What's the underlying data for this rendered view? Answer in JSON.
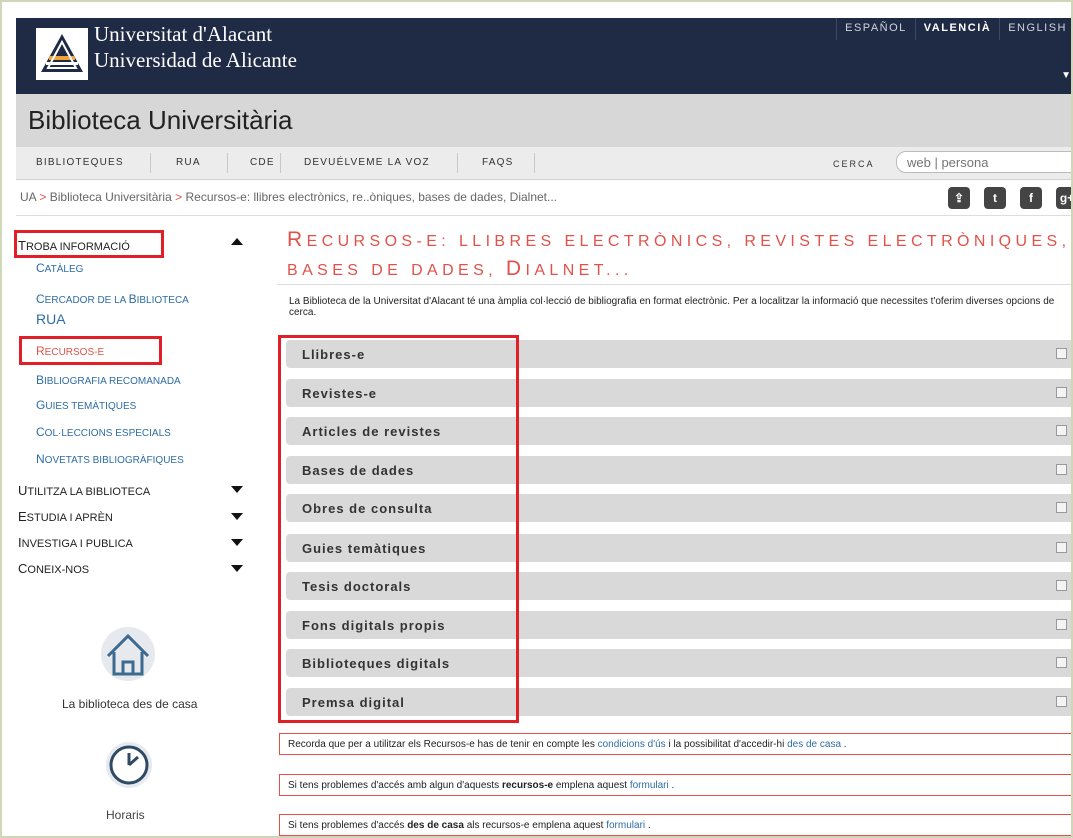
{
  "header": {
    "university_ca": "Universitat d'Alacant",
    "university_es": "Universidad de Alicante",
    "languages": [
      "ESPAÑOL",
      "VALENCIÀ",
      "ENGLISH"
    ],
    "site_title": "Biblioteca Universitària"
  },
  "nav": {
    "items": [
      "BIBLIOTEQUES",
      "RUA",
      "CDE",
      "DEVUÉLVEME LA VOZ",
      "FAQS"
    ],
    "search_label": "CERCA",
    "search_placeholder": "web | persona"
  },
  "breadcrumb": {
    "home": "UA",
    "level1": "Biblioteca Universitària",
    "current": "Recursos-e: llibres electrònics, re..òniques, bases de dades, Dialnet...",
    "separator": ">",
    "social_icons": [
      "share-icon",
      "twitter-icon",
      "facebook-icon",
      "google-plus-icon"
    ],
    "social_glyphs": [
      "⇪",
      "t",
      "f",
      "g+"
    ]
  },
  "sidebar": {
    "sections": [
      {
        "label_cap": "T",
        "label_rest": "roba informació"
      },
      {
        "label_cap": "U",
        "label_rest": "tilitza la biblioteca"
      },
      {
        "label_cap": "E",
        "label_rest": "studia i aprèn"
      },
      {
        "label_cap": "I",
        "label_rest": "nvestiga i publica"
      },
      {
        "label_cap": "C",
        "label_rest": "oneix-nos"
      }
    ],
    "subitems": [
      {
        "cap": "C",
        "rest": "atàleg"
      },
      {
        "cap": "C",
        "rest": "ercador de la ",
        "cap2": "B",
        "rest2": "iblioteca"
      },
      {
        "text": "RUA"
      },
      {
        "cap": "R",
        "rest": "ecursos-e"
      },
      {
        "cap": "B",
        "rest": "ibliografia recomanada"
      },
      {
        "cap": "G",
        "rest": "uies temàtiques"
      },
      {
        "cap": "C",
        "rest": "ol·leccions especials"
      },
      {
        "cap": "N",
        "rest": "ovetats bibliogràfiques"
      }
    ],
    "home_label": "La biblioteca des de casa",
    "clock_label": "Horaris"
  },
  "main": {
    "title_line1_cap": "R",
    "title_line1_rest": "ecursos-e: llibres electrònics, revistes electròniques,",
    "title_line2_rest": "bases de dades, ",
    "title_line2_cap": "D",
    "title_line2_rest2": "ialnet...",
    "intro": "La Biblioteca de la Universitat d'Alacant té una àmplia col·lecció de bibliografia en format electrònic. Per a localitzar la informació que necessites t'oferim diverses opcions de cerca.",
    "accordion": [
      "Llibres-e",
      "Revistes-e",
      "Articles de revistes",
      "Bases de dades",
      "Obres de consulta",
      "Guies temàtiques",
      "Tesis doctorals",
      "Fons digitals propis",
      "Biblioteques digitals",
      "Premsa digital"
    ],
    "notice1": {
      "pre": "Recorda que per a utilitzar els Recursos-e has de tenir en compte les ",
      "link1": "condicions d'ús",
      "mid": " i la possibilitat d'accedir-hi ",
      "link2": "des de casa",
      "post": " ."
    },
    "notice2": {
      "pre": "Si tens problemes d'accés amb algun d'aquests ",
      "bold": "recursos-e",
      "mid": " emplena aquest ",
      "link": "formulari",
      "post": " ."
    },
    "notice3": {
      "pre": "Si tens problemes d'accés ",
      "bold": "des de casa",
      "mid": " als recursos-e emplena aquest ",
      "link": "formulari",
      "post": " ."
    }
  },
  "colors": {
    "accent": "#e0524a",
    "link": "#2e6da4",
    "header_bg": "#1f2a44",
    "highlight": "#e01f26"
  }
}
